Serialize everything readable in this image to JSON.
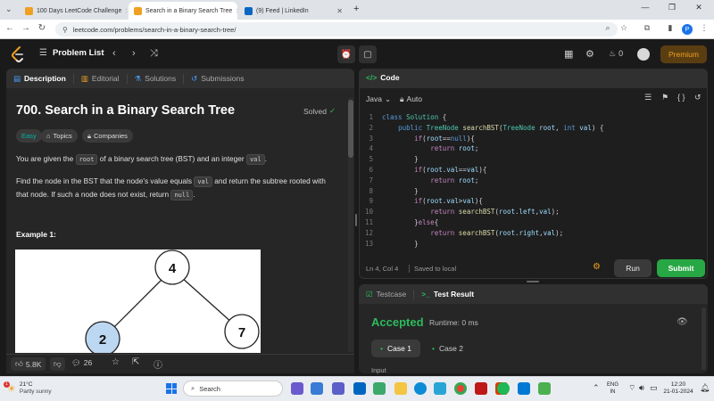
{
  "browser": {
    "tabs": [
      {
        "title": "100 Days LeetCode Challenge",
        "active": false
      },
      {
        "title": "Search in a Binary Search Tree",
        "active": true
      },
      {
        "title": "(9) Feed | LinkedIn",
        "active": false
      }
    ],
    "url": "leetcode.com/problems/search-in-a-binary-search-tree/",
    "profile_letter": "P"
  },
  "navbar": {
    "problem_list": "Problem List",
    "streak": "0",
    "premium": "Premium"
  },
  "left": {
    "tabs": [
      "Description",
      "Editorial",
      "Solutions",
      "Submissions"
    ],
    "title": "700. Search in a Binary Search Tree",
    "solved": "Solved",
    "difficulty": "Easy",
    "topics": "Topics",
    "companies": "Companies",
    "para1": {
      "a": "You are given the ",
      "c1": "root",
      "b": " of a binary search tree (BST) and an integer ",
      "c2": "val",
      "d": "."
    },
    "para2": {
      "a": "Find the node in the BST that the node's value equals ",
      "c1": "val",
      "b": " and return the subtree rooted with that node. If such a node does not exist, return ",
      "c2": "null",
      "d": "."
    },
    "example": "Example 1:",
    "tree": {
      "root": "4",
      "left": "2",
      "right": "7"
    },
    "likes": "5.8K",
    "comments": "26"
  },
  "code": {
    "tab": "Code",
    "language": "Java",
    "mode": "Auto",
    "status_pos": "Ln 4, Col 4",
    "status_saved": "Saved to local",
    "run": "Run",
    "submit": "Submit"
  },
  "result": {
    "testcase_tab": "Testcase",
    "result_tab": "Test Result",
    "status": "Accepted",
    "runtime": "Runtime: 0 ms",
    "cases": [
      "Case 1",
      "Case 2"
    ],
    "input_label": "Input"
  },
  "taskbar": {
    "weather_temp": "21°C",
    "weather_desc": "Partly sunny",
    "weather_badge": "1",
    "search": "Search",
    "lang1": "ENG",
    "lang2": "IN",
    "time": "12:20",
    "date": "21-01-2024"
  },
  "colors": {
    "accent_green": "#2cbb5d",
    "premium": "#f0a020",
    "easy": "#00b8a3"
  }
}
